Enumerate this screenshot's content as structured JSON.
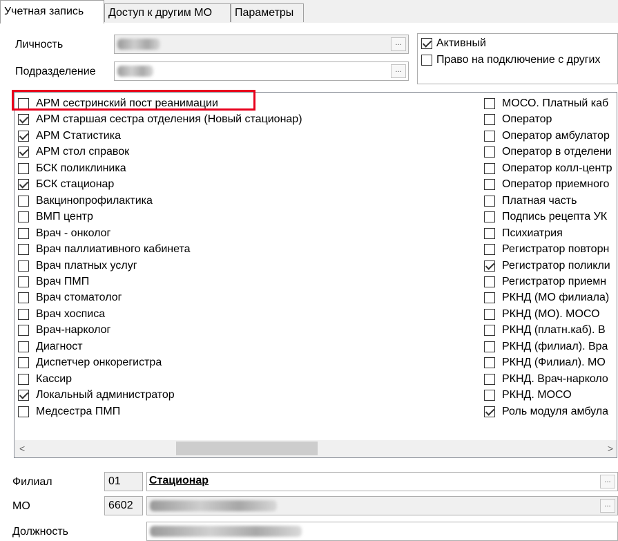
{
  "tabs": [
    "Учетная запись",
    "Доступ к другим МО",
    "Параметры"
  ],
  "form": {
    "personality_label": "Личность",
    "department_label": "Подразделение",
    "ellipsis": "...",
    "active_label": "Активный",
    "connect_right_label": "Право на подключение с других"
  },
  "roles_left": [
    {
      "label": "АРМ сестринский пост реанимации",
      "checked": false
    },
    {
      "label": "АРМ старшая сестра отделения (Новый стационар)",
      "checked": true
    },
    {
      "label": "АРМ Статистика",
      "checked": true
    },
    {
      "label": "АРМ стол справок",
      "checked": true
    },
    {
      "label": "БСК поликлиника",
      "checked": false
    },
    {
      "label": "БСК стационар",
      "checked": true
    },
    {
      "label": "Вакцинопрофилактика",
      "checked": false
    },
    {
      "label": "ВМП центр",
      "checked": false
    },
    {
      "label": "Врач - онколог",
      "checked": false
    },
    {
      "label": "Врач паллиативного кабинета",
      "checked": false
    },
    {
      "label": "Врач платных услуг",
      "checked": false
    },
    {
      "label": "Врач ПМП",
      "checked": false
    },
    {
      "label": "Врач стоматолог",
      "checked": false
    },
    {
      "label": "Врач хосписа",
      "checked": false
    },
    {
      "label": "Врач-нарколог",
      "checked": false
    },
    {
      "label": "Диагност",
      "checked": false
    },
    {
      "label": "Диспетчер онкорегистра",
      "checked": false
    },
    {
      "label": "Кассир",
      "checked": false
    },
    {
      "label": "Локальный администратор",
      "checked": true
    },
    {
      "label": "Медсестра ПМП",
      "checked": false
    }
  ],
  "roles_right": [
    {
      "label": "МОСО. Платный каб",
      "checked": false
    },
    {
      "label": "Оператор",
      "checked": false
    },
    {
      "label": "Оператор амбулатор",
      "checked": false
    },
    {
      "label": "Оператор в отделени",
      "checked": false
    },
    {
      "label": "Оператор колл-центр",
      "checked": false
    },
    {
      "label": "Оператор приемного",
      "checked": false
    },
    {
      "label": "Платная часть",
      "checked": false
    },
    {
      "label": "Подпись рецепта УК",
      "checked": false
    },
    {
      "label": "Психиатрия",
      "checked": false
    },
    {
      "label": "Регистратор повторн",
      "checked": false
    },
    {
      "label": "Регистратор поликли",
      "checked": true
    },
    {
      "label": "Регистратор приемн",
      "checked": false
    },
    {
      "label": "РКНД (МО филиала)",
      "checked": false
    },
    {
      "label": "РКНД (МО). МОСО",
      "checked": false
    },
    {
      "label": "РКНД (платн.каб). В",
      "checked": false
    },
    {
      "label": "РКНД (филиал). Вра",
      "checked": false
    },
    {
      "label": "РКНД (Филиал). МО",
      "checked": false
    },
    {
      "label": "РКНД. Врач-нарколо",
      "checked": false
    },
    {
      "label": "РКНД. МОСО",
      "checked": false
    },
    {
      "label": "Роль модуля амбула",
      "checked": true
    }
  ],
  "scroll": {
    "left_arrow": "<",
    "right_arrow": ">"
  },
  "bottom": {
    "branch_label": "Филиал",
    "branch_code": "01",
    "branch_name": "Стационар",
    "mo_label": "МО",
    "mo_code": "6602",
    "position_label": "Должность"
  },
  "colors": {
    "highlight": "#e8001c"
  }
}
